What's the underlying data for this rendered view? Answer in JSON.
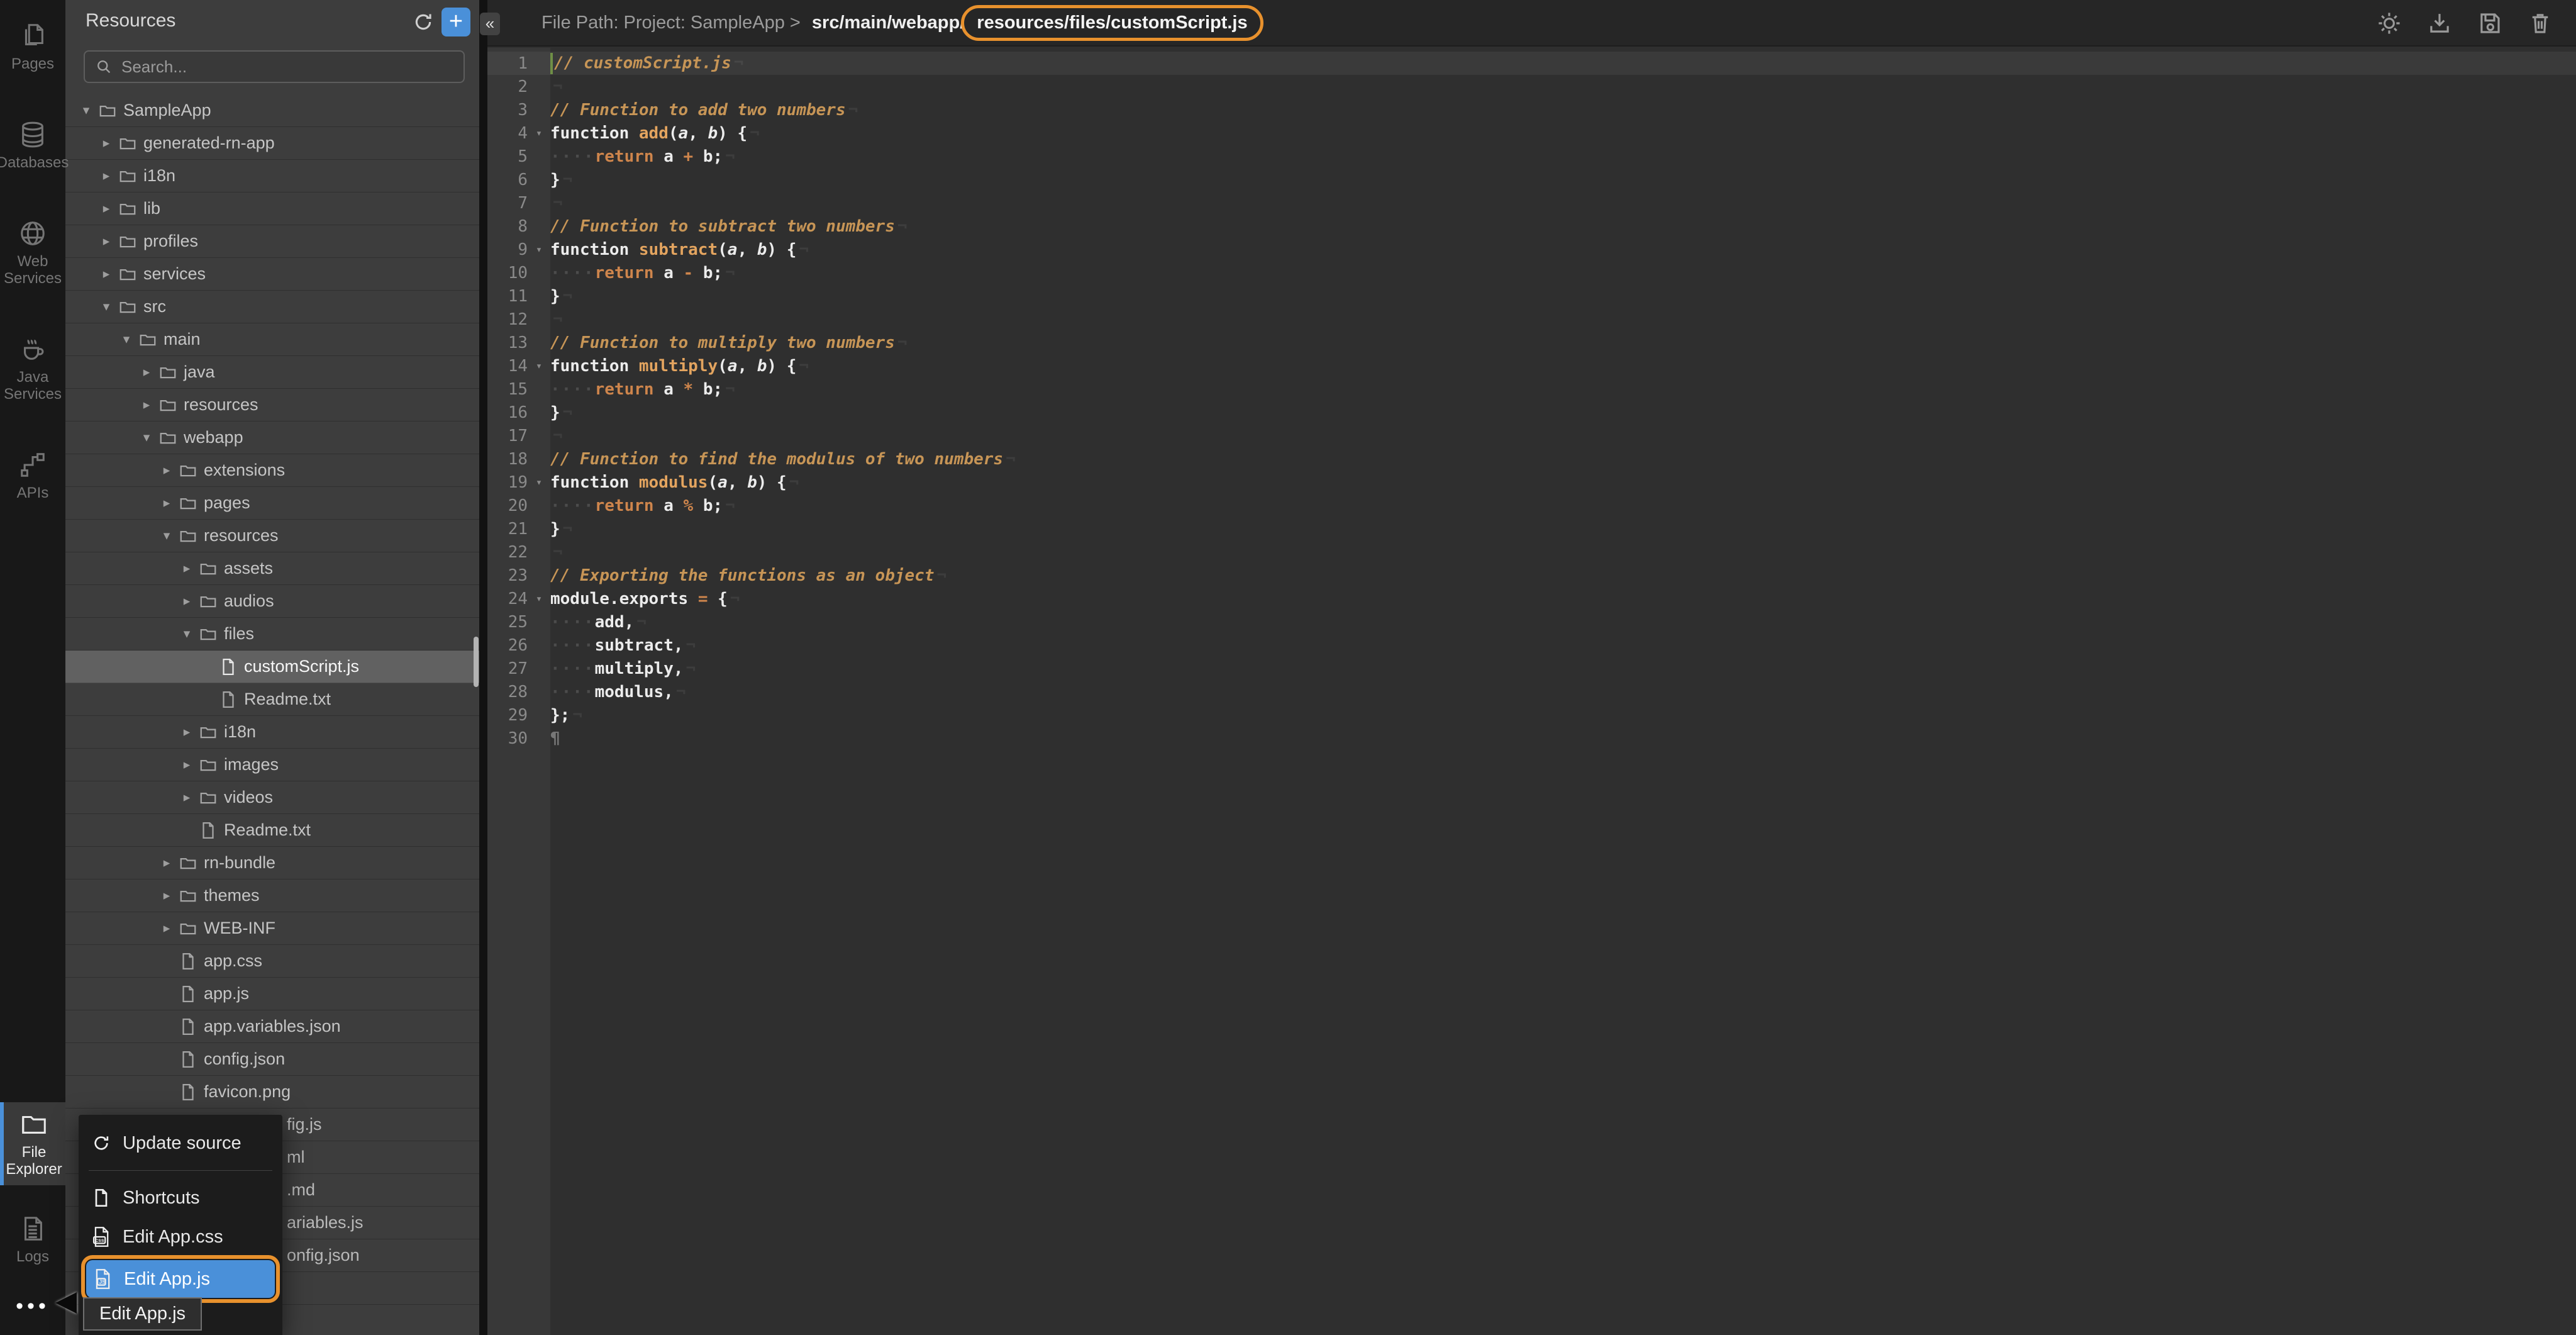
{
  "colors": {
    "accent_blue": "#4A90D9",
    "annotation_orange": "#E8912D",
    "selected_row_gray": "#616161",
    "comment_orange": "#C79556",
    "keyword_orange": "#CE854C",
    "function_name_orange": "#E3A45F"
  },
  "sidebar": {
    "top": [
      {
        "label": "Pages"
      },
      {
        "label": "Databases"
      },
      {
        "label": "Web Services"
      },
      {
        "label": "Java Services"
      },
      {
        "label": "APIs"
      }
    ],
    "bottom": [
      {
        "label": "File Explorer",
        "active": true
      },
      {
        "label": "Logs",
        "active": false
      }
    ],
    "more_label": "•••"
  },
  "explorer": {
    "title": "Resources",
    "search_placeholder": "Search...",
    "tree": [
      {
        "label": "SampleApp",
        "level": 0,
        "kind": "folder",
        "state": "expanded"
      },
      {
        "label": "generated-rn-app",
        "level": 1,
        "kind": "folder",
        "state": "collapsed"
      },
      {
        "label": "i18n",
        "level": 1,
        "kind": "folder",
        "state": "collapsed"
      },
      {
        "label": "lib",
        "level": 1,
        "kind": "folder",
        "state": "collapsed"
      },
      {
        "label": "profiles",
        "level": 1,
        "kind": "folder",
        "state": "collapsed"
      },
      {
        "label": "services",
        "level": 1,
        "kind": "folder",
        "state": "collapsed"
      },
      {
        "label": "src",
        "level": 1,
        "kind": "folder",
        "state": "expanded"
      },
      {
        "label": "main",
        "level": 2,
        "kind": "folder",
        "state": "expanded"
      },
      {
        "label": "java",
        "level": 3,
        "kind": "folder",
        "state": "collapsed"
      },
      {
        "label": "resources",
        "level": 3,
        "kind": "folder",
        "state": "collapsed"
      },
      {
        "label": "webapp",
        "level": 3,
        "kind": "folder",
        "state": "expanded"
      },
      {
        "label": "extensions",
        "level": 4,
        "kind": "folder",
        "state": "collapsed"
      },
      {
        "label": "pages",
        "level": 4,
        "kind": "folder",
        "state": "collapsed"
      },
      {
        "label": "resources",
        "level": 4,
        "kind": "folder",
        "state": "expanded"
      },
      {
        "label": "assets",
        "level": 5,
        "kind": "folder",
        "state": "collapsed"
      },
      {
        "label": "audios",
        "level": 5,
        "kind": "folder",
        "state": "collapsed"
      },
      {
        "label": "files",
        "level": 5,
        "kind": "folder",
        "state": "expanded"
      },
      {
        "label": "customScript.js",
        "level": 6,
        "kind": "file",
        "selected": true
      },
      {
        "label": "Readme.txt",
        "level": 6,
        "kind": "file"
      },
      {
        "label": "i18n",
        "level": 5,
        "kind": "folder",
        "state": "collapsed"
      },
      {
        "label": "images",
        "level": 5,
        "kind": "folder",
        "state": "collapsed"
      },
      {
        "label": "videos",
        "level": 5,
        "kind": "folder",
        "state": "collapsed"
      },
      {
        "label": "Readme.txt",
        "level": 5,
        "kind": "file"
      },
      {
        "label": "rn-bundle",
        "level": 4,
        "kind": "folder",
        "state": "collapsed"
      },
      {
        "label": "themes",
        "level": 4,
        "kind": "folder",
        "state": "collapsed"
      },
      {
        "label": "WEB-INF",
        "level": 4,
        "kind": "folder",
        "state": "collapsed"
      },
      {
        "label": "app.css",
        "level": 4,
        "kind": "file"
      },
      {
        "label": "app.js",
        "level": 4,
        "kind": "file"
      },
      {
        "label": "app.variables.json",
        "level": 4,
        "kind": "file"
      },
      {
        "label": "config.json",
        "level": 4,
        "kind": "file"
      },
      {
        "label": "favicon.png",
        "level": 4,
        "kind": "file"
      }
    ],
    "occluded_rows": [
      {
        "fragment": "fig.js"
      },
      {
        "fragment": "ml"
      },
      {
        "fragment": ".md"
      },
      {
        "fragment": "ariables.js"
      },
      {
        "fragment": "onfig.json"
      },
      {
        "fragment": ""
      },
      {
        "fragment": ""
      }
    ]
  },
  "path_bar": {
    "prefix": "File Path: Project: SampleApp >",
    "mid": " src/main/webapp/",
    "highlight": "resources/files/customScript.js"
  },
  "toolbar": {
    "icons": [
      {
        "name": "settings"
      },
      {
        "name": "download"
      },
      {
        "name": "save"
      },
      {
        "name": "delete"
      }
    ]
  },
  "editor": {
    "filename": "customScript.js",
    "lines": [
      {
        "no": 1,
        "current": true,
        "caret": true,
        "tokens": [
          [
            "cm",
            "// customScript.js"
          ]
        ]
      },
      {
        "no": 2,
        "tokens": []
      },
      {
        "no": 3,
        "tokens": [
          [
            "cm",
            "// Function to add two numbers"
          ]
        ]
      },
      {
        "no": 4,
        "fold": true,
        "tokens": [
          [
            "pl",
            "function "
          ],
          [
            "fn",
            "add"
          ],
          [
            "pl",
            "("
          ],
          [
            "prm",
            "a"
          ],
          [
            "pl",
            ", "
          ],
          [
            "prm",
            "b"
          ],
          [
            "pl",
            ") {"
          ]
        ]
      },
      {
        "no": 5,
        "tokens": [
          [
            "ws",
            "····"
          ],
          [
            "ret",
            "return"
          ],
          [
            "pl",
            " a "
          ],
          [
            "op",
            "+"
          ],
          [
            "pl",
            " b;"
          ]
        ]
      },
      {
        "no": 6,
        "tokens": [
          [
            "pl",
            "}"
          ]
        ]
      },
      {
        "no": 7,
        "tokens": []
      },
      {
        "no": 8,
        "tokens": [
          [
            "cm",
            "// Function to subtract two numbers"
          ]
        ]
      },
      {
        "no": 9,
        "fold": true,
        "tokens": [
          [
            "pl",
            "function "
          ],
          [
            "fn",
            "subtract"
          ],
          [
            "pl",
            "("
          ],
          [
            "prm",
            "a"
          ],
          [
            "pl",
            ", "
          ],
          [
            "prm",
            "b"
          ],
          [
            "pl",
            ") {"
          ]
        ]
      },
      {
        "no": 10,
        "tokens": [
          [
            "ws",
            "····"
          ],
          [
            "ret",
            "return"
          ],
          [
            "pl",
            " a "
          ],
          [
            "op",
            "-"
          ],
          [
            "pl",
            " b;"
          ]
        ]
      },
      {
        "no": 11,
        "tokens": [
          [
            "pl",
            "}"
          ]
        ]
      },
      {
        "no": 12,
        "tokens": []
      },
      {
        "no": 13,
        "tokens": [
          [
            "cm",
            "// Function to multiply two numbers"
          ]
        ]
      },
      {
        "no": 14,
        "fold": true,
        "tokens": [
          [
            "pl",
            "function "
          ],
          [
            "fn",
            "multiply"
          ],
          [
            "pl",
            "("
          ],
          [
            "prm",
            "a"
          ],
          [
            "pl",
            ", "
          ],
          [
            "prm",
            "b"
          ],
          [
            "pl",
            ") {"
          ]
        ]
      },
      {
        "no": 15,
        "tokens": [
          [
            "ws",
            "····"
          ],
          [
            "ret",
            "return"
          ],
          [
            "pl",
            " a "
          ],
          [
            "op",
            "*"
          ],
          [
            "pl",
            " b;"
          ]
        ]
      },
      {
        "no": 16,
        "tokens": [
          [
            "pl",
            "}"
          ]
        ]
      },
      {
        "no": 17,
        "tokens": []
      },
      {
        "no": 18,
        "tokens": [
          [
            "cm",
            "// Function to find the modulus of two numbers"
          ]
        ]
      },
      {
        "no": 19,
        "fold": true,
        "tokens": [
          [
            "pl",
            "function "
          ],
          [
            "fn",
            "modulus"
          ],
          [
            "pl",
            "("
          ],
          [
            "prm",
            "a"
          ],
          [
            "pl",
            ", "
          ],
          [
            "prm",
            "b"
          ],
          [
            "pl",
            ") {"
          ]
        ]
      },
      {
        "no": 20,
        "tokens": [
          [
            "ws",
            "····"
          ],
          [
            "ret",
            "return"
          ],
          [
            "pl",
            " a "
          ],
          [
            "op",
            "%"
          ],
          [
            "pl",
            " b;"
          ]
        ]
      },
      {
        "no": 21,
        "tokens": [
          [
            "pl",
            "}"
          ]
        ]
      },
      {
        "no": 22,
        "tokens": []
      },
      {
        "no": 23,
        "tokens": [
          [
            "cm",
            "// Exporting the functions as an object"
          ]
        ]
      },
      {
        "no": 24,
        "fold": true,
        "tokens": [
          [
            "pl",
            "module.exports "
          ],
          [
            "op",
            "="
          ],
          [
            "pl",
            " {"
          ]
        ]
      },
      {
        "no": 25,
        "tokens": [
          [
            "ws",
            "····"
          ],
          [
            "pl",
            "add,"
          ]
        ]
      },
      {
        "no": 26,
        "tokens": [
          [
            "ws",
            "····"
          ],
          [
            "pl",
            "subtract,"
          ]
        ]
      },
      {
        "no": 27,
        "tokens": [
          [
            "ws",
            "····"
          ],
          [
            "pl",
            "multiply,"
          ]
        ]
      },
      {
        "no": 28,
        "tokens": [
          [
            "ws",
            "····"
          ],
          [
            "pl",
            "modulus,"
          ]
        ]
      },
      {
        "no": 29,
        "tokens": [
          [
            "pl",
            "};"
          ]
        ]
      },
      {
        "no": 30,
        "eol": false,
        "tokens": [
          [
            "eof",
            "¶"
          ]
        ]
      }
    ]
  },
  "context_menu": {
    "items": [
      {
        "icon": "refresh",
        "label": "Update source"
      },
      {
        "divider": true
      },
      {
        "icon": "file",
        "label": "Shortcuts"
      },
      {
        "icon": "css-file",
        "label": "Edit App.css"
      },
      {
        "icon": "js-file",
        "label": "Edit App.js",
        "highlighted": true
      }
    ]
  },
  "tooltip": {
    "text": "Edit App.js"
  }
}
